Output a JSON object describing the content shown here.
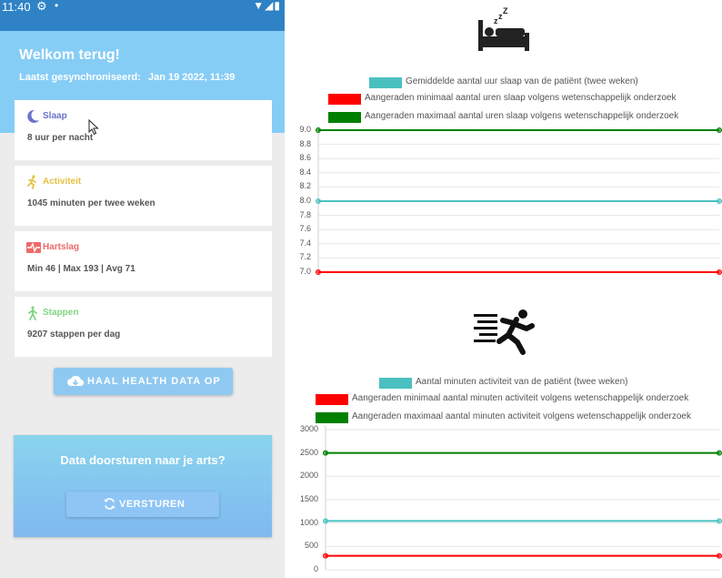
{
  "status_bar": {
    "time": "11:40",
    "gear": "⚙",
    "dot": "•",
    "icons": "▼◢▮"
  },
  "header": {
    "welcome": "Welkom terug!",
    "sync_label": "Laatst gesynchroniseerd:",
    "sync_value": "Jan 19 2022, 11:39"
  },
  "cards": [
    {
      "title": "Slaap",
      "value": "8 uur per nacht",
      "color": "#6a74c9",
      "icon": "moon-icon"
    },
    {
      "title": "Activiteit",
      "value": "1045 minuten per twee weken",
      "color": "#e6c244",
      "icon": "runner-icon"
    },
    {
      "title": "Hartslag",
      "value": "Min 46 | Max 193 | Avg 71",
      "color": "#ee6a6a",
      "icon": "heartbeat-icon"
    },
    {
      "title": "Stappen",
      "value": "9207 stappen per dag",
      "color": "#7fd67f",
      "icon": "walker-icon"
    }
  ],
  "buttons": {
    "haal_label": "HAAL HEALTH DATA OP",
    "send_prompt": "Data doorsturen naar je arts?",
    "send_label": "VERSTUREN"
  },
  "chart_data": [
    {
      "type": "line",
      "icon": "bed-sleep-icon",
      "x": [
        "",
        ""
      ],
      "series": [
        {
          "name": "Gemiddelde aantal uur slaap van de patiënt (twee weken)",
          "color": "#4bc0c0",
          "values": [
            8.0,
            8.0
          ]
        },
        {
          "name": "Aangeraden minimaal aantal uren slaap volgens wetenschappelijk onderzoek",
          "color": "#ff0000",
          "values": [
            7.0,
            7.0
          ]
        },
        {
          "name": "Aangeraden maximaal aantal uren slaap volgens wetenschappelijk onderzoek",
          "color": "#008000",
          "values": [
            9.0,
            9.0
          ]
        }
      ],
      "ylim": [
        7.0,
        9.0
      ],
      "yticks": [
        "9.0",
        "8.8",
        "8.6",
        "8.4",
        "8.2",
        "8.0",
        "7.8",
        "7.6",
        "7.4",
        "7.2",
        "7.0"
      ],
      "grid": true,
      "legend": "top"
    },
    {
      "type": "line",
      "icon": "running-person-icon",
      "x": [
        "",
        ""
      ],
      "series": [
        {
          "name": "Aantal minuten activiteit van de patiënt (twee weken)",
          "color": "#4bc0c0",
          "values": [
            1045,
            1045
          ]
        },
        {
          "name": "Aangeraden minimaal aantal minuten activiteit volgens wetenschappelijk onderzoek",
          "color": "#ff0000",
          "values": [
            300,
            300
          ]
        },
        {
          "name": "Aangeraden maximaal aantal minuten activiteit volgens wetenschappelijk onderzoek",
          "color": "#008000",
          "values": [
            2500,
            2500
          ]
        }
      ],
      "ylim": [
        0,
        3000
      ],
      "yticks": [
        "3000",
        "2500",
        "2000",
        "1500",
        "1000",
        "500",
        "0"
      ],
      "grid": true,
      "legend": "top"
    }
  ]
}
